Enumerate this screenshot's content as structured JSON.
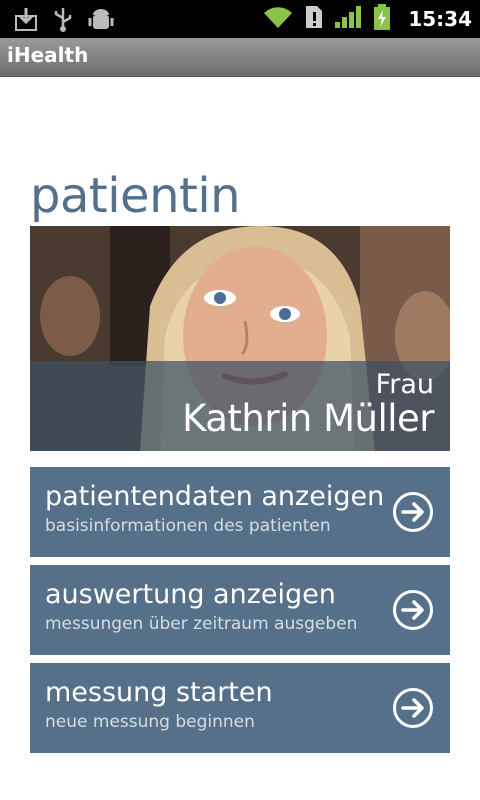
{
  "status_bar": {
    "time": "15:34",
    "icons": [
      "download-icon",
      "usb-icon",
      "android-debug-icon",
      "wifi-icon",
      "sim-alert-icon",
      "signal-icon",
      "battery-charging-icon"
    ]
  },
  "title_bar": {
    "title": "iHealth"
  },
  "page": {
    "heading": "patientin"
  },
  "patient": {
    "salutation": "Frau",
    "name": "Kathrin Müller"
  },
  "actions": [
    {
      "title": "patientendaten anzeigen",
      "subtitle": "basisinformationen des patienten",
      "icon": "arrow-right-circle-icon"
    },
    {
      "title": "auswertung anzeigen",
      "subtitle": "messungen über zeitraum ausgeben",
      "icon": "arrow-right-circle-icon"
    },
    {
      "title": "messung starten",
      "subtitle": "neue messung beginnen",
      "icon": "arrow-right-circle-icon"
    }
  ],
  "colors": {
    "accent": "#56708a",
    "heading": "#55708a",
    "status_green": "#8bc34a"
  }
}
